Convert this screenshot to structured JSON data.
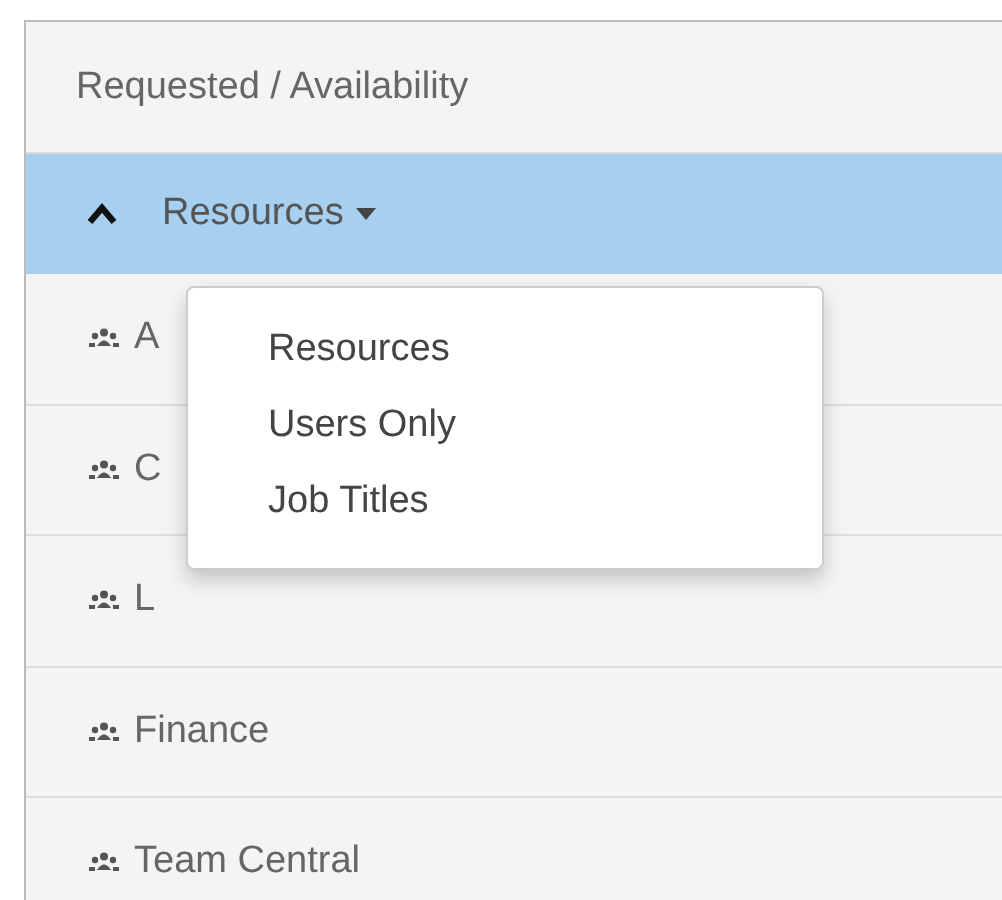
{
  "header": {
    "label": "Requested / Availability"
  },
  "group_bar": {
    "expanded": true,
    "label": "Resources"
  },
  "rows": [
    {
      "label": "A"
    },
    {
      "label": "C"
    },
    {
      "label": "L"
    },
    {
      "label": "Finance"
    },
    {
      "label": "Team Central"
    }
  ],
  "dropdown": {
    "items": [
      {
        "label": "Resources"
      },
      {
        "label": "Users Only"
      },
      {
        "label": "Job Titles"
      }
    ]
  }
}
